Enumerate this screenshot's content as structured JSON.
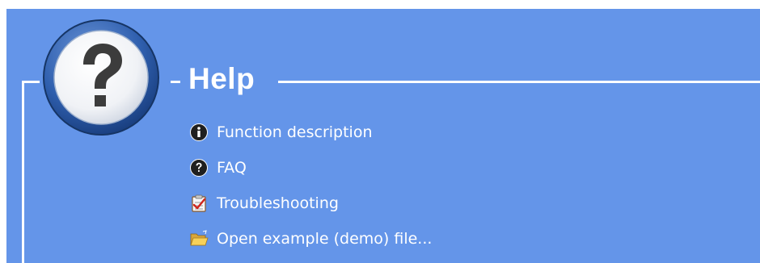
{
  "help_panel": {
    "title": "Help",
    "big_icon": "help-question-icon",
    "colors": {
      "background": "#6495e9",
      "text": "#ffffff",
      "lines": "#ffffff"
    },
    "items": [
      {
        "label": "Function description",
        "icon": "info-icon"
      },
      {
        "label": "FAQ",
        "icon": "question-icon"
      },
      {
        "label": "Troubleshooting",
        "icon": "checklist-icon"
      },
      {
        "label": "Open example (demo) file...",
        "icon": "folder-open-icon"
      }
    ]
  }
}
